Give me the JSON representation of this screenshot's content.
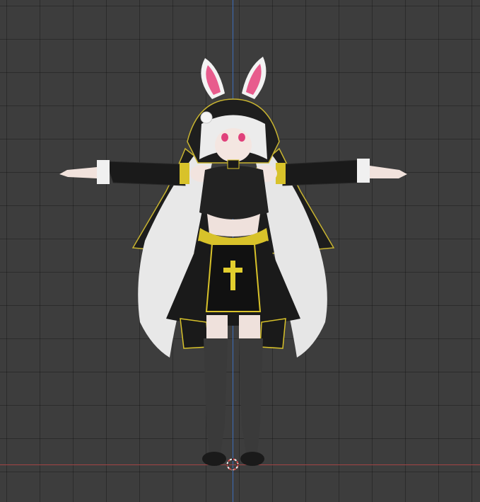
{
  "viewport": {
    "background_color": "#3d3d3d",
    "grid_color": "#2b2b2b",
    "z_axis_color": "#3d6db8",
    "x_axis_color": "#a34545",
    "origin_icon": "3d-cursor-icon",
    "model": "anime-bunny-nun-character-tpose"
  }
}
